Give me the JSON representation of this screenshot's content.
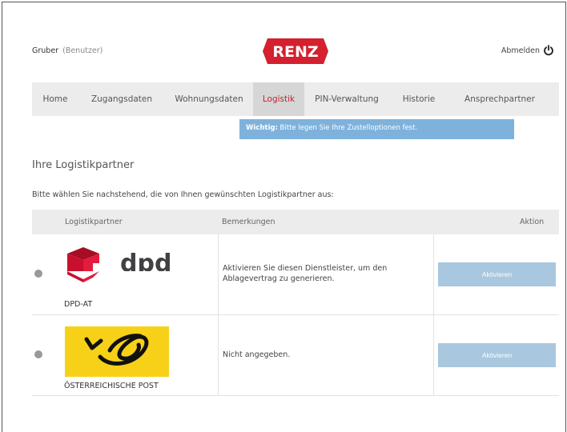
{
  "header": {
    "user_name": "Gruber",
    "user_role": "(Benutzer)",
    "logo_text": "RENZ",
    "logout_label": "Abmelden",
    "brand_color": "#d4202f"
  },
  "nav": {
    "items": [
      {
        "label": "Home"
      },
      {
        "label": "Zugangsdaten"
      },
      {
        "label": "Wohnungsdaten"
      },
      {
        "label": "Logistik",
        "active": true
      },
      {
        "label": "PIN-Verwaltung"
      },
      {
        "label": "Historie"
      },
      {
        "label": "Ansprechpartner"
      }
    ]
  },
  "notice": {
    "strong": "Wichtig:",
    "text": " Bitte legen Sie Ihre Zustelloptionen fest."
  },
  "page": {
    "title": "Ihre Logistikpartner",
    "intro": "Bitte wählen Sie nachstehend, die von Ihnen gewünschten Logistikpartner aus:"
  },
  "table": {
    "headers": {
      "partner": "Logistikpartner",
      "remarks": "Bemerkungen",
      "action": "Aktion"
    },
    "rows": [
      {
        "partner_name": "DPD-AT",
        "logo_text": "dpd",
        "logo_icon": "dpd-cube-logo",
        "remark_line1": "Aktivieren Sie diesen Dienstleister, um den",
        "remark_line2": "Ablagevertrag zu generieren.",
        "action_label": "Aktivieren"
      },
      {
        "partner_name": "ÖSTERREICHISCHE POST",
        "logo_icon": "post-horn-logo",
        "remark_line1": "Nicht angegeben.",
        "remark_line2": "",
        "action_label": "Aktivieren"
      }
    ]
  },
  "colors": {
    "nav_bg": "#ececec",
    "nav_active_bg": "#d6d6d6",
    "nav_active_text": "#c8202f",
    "notice_bg": "#7eb2dc",
    "button_bg": "#a9c7de",
    "post_yellow": "#f7d117",
    "dpd_red": "#c8102e"
  }
}
